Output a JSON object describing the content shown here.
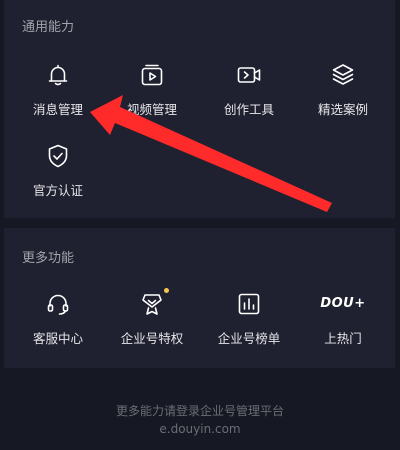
{
  "sections": [
    {
      "title": "通用能力",
      "items": [
        {
          "label": "消息管理",
          "icon": "bell-icon"
        },
        {
          "label": "视频管理",
          "icon": "video-library-icon"
        },
        {
          "label": "创作工具",
          "icon": "video-camera-icon"
        },
        {
          "label": "精选案例",
          "icon": "layers-icon"
        },
        {
          "label": "官方认证",
          "icon": "shield-check-icon"
        }
      ]
    },
    {
      "title": "更多功能",
      "items": [
        {
          "label": "客服中心",
          "icon": "headset-icon"
        },
        {
          "label": "企业号特权",
          "icon": "medal-icon",
          "badge": true
        },
        {
          "label": "企业号榜单",
          "icon": "bar-chart-icon"
        },
        {
          "label": "上热门",
          "icon": "dou-plus-icon",
          "icon_text": "DOU+"
        }
      ]
    }
  ],
  "footer": {
    "line1": "更多能力请登录企业号管理平台",
    "line2": "e.douyin.com"
  },
  "colors": {
    "background": "#161823",
    "panel": "#1f2030",
    "badge": "#f5c44e",
    "annotation_arrow": "#ff2a2a"
  }
}
